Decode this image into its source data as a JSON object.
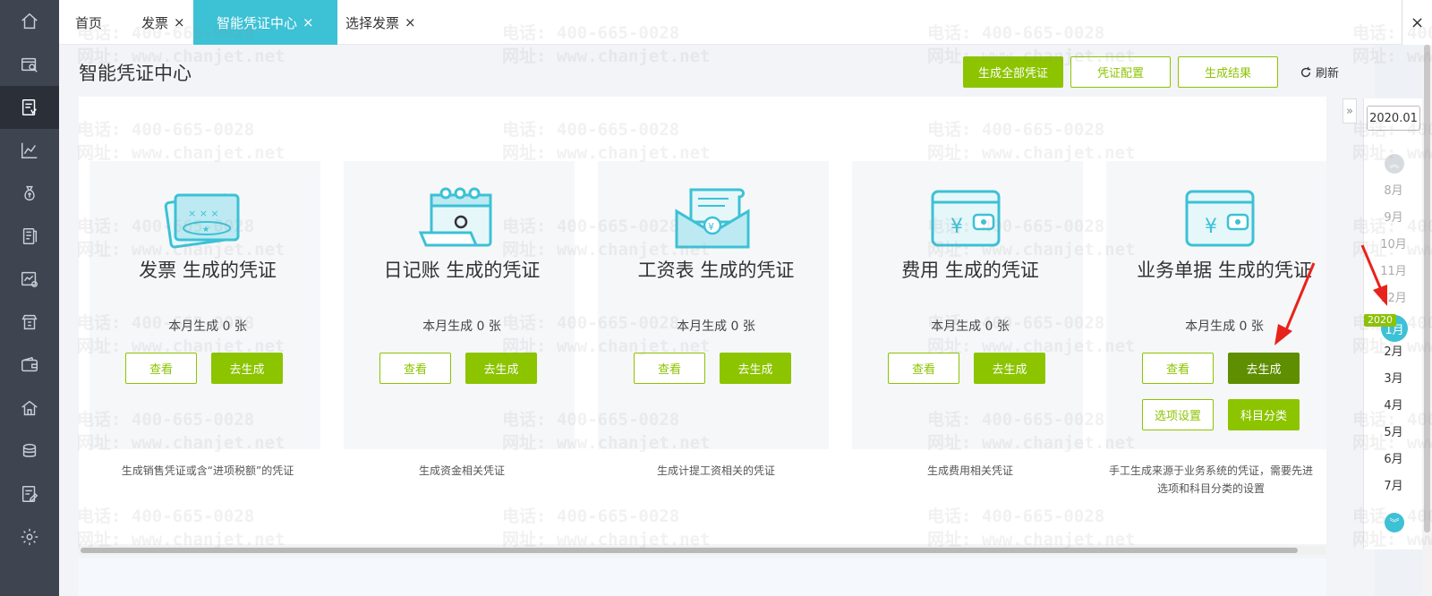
{
  "tabs": [
    {
      "label": "首页",
      "closable": false
    },
    {
      "label": "发票",
      "closable": true
    },
    {
      "label": "智能凭证中心",
      "closable": true,
      "active": true
    },
    {
      "label": "选择发票",
      "closable": true
    }
  ],
  "close_all_icon": "×",
  "tab_close_icon": "×",
  "watermark": {
    "phone": "电话: 400-665-0028",
    "site": "网址: www.chanjet.net"
  },
  "page": {
    "title": "智能凭证中心",
    "btn_generate_all": "生成全部凭证",
    "btn_config": "凭证配置",
    "btn_results": "生成结果",
    "btn_refresh": "刷新"
  },
  "cards": [
    {
      "title": "发票 生成的凭证",
      "count": "本月生成  0 张",
      "view": "查看",
      "generate": "去生成",
      "desc": "生成销售凭证或含“进项税额”的凭证",
      "icon": "invoice-ticket-icon"
    },
    {
      "title": "日记账 生成的凭证",
      "count": "本月生成  0 张",
      "view": "查看",
      "generate": "去生成",
      "desc": "生成资金相关凭证",
      "icon": "journal-calendar-icon"
    },
    {
      "title": "工资表 生成的凭证",
      "count": "本月生成  0 张",
      "view": "查看",
      "generate": "去生成",
      "desc": "生成计提工资相关的凭证",
      "icon": "salary-envelope-icon"
    },
    {
      "title": "费用 生成的凭证",
      "count": "本月生成  0 张",
      "view": "查看",
      "generate": "去生成",
      "desc": "生成费用相关凭证",
      "icon": "expense-wallet-icon"
    },
    {
      "title": "业务单据 生成的凭证",
      "count": "本月生成  0 张",
      "view": "查看",
      "generate": "去生成",
      "options": "选项设置",
      "subject": "科目分类",
      "desc": "手工生成来源于业务系统的凭证，需要先进",
      "desc2": "选项和科目分类的设置",
      "icon": "business-wallet-icon"
    }
  ],
  "period": {
    "value": "2020.01",
    "year_badge": "2020",
    "months_before": [
      "8月",
      "9月",
      "10月",
      "11月",
      "12月"
    ],
    "current": "1月",
    "months_after": [
      "2月",
      "3月",
      "4月",
      "5月",
      "6月",
      "7月"
    ]
  },
  "colors": {
    "accent_green": "#8cc400",
    "accent_teal": "#3cc1d5",
    "nav_bg": "#3e4450"
  }
}
